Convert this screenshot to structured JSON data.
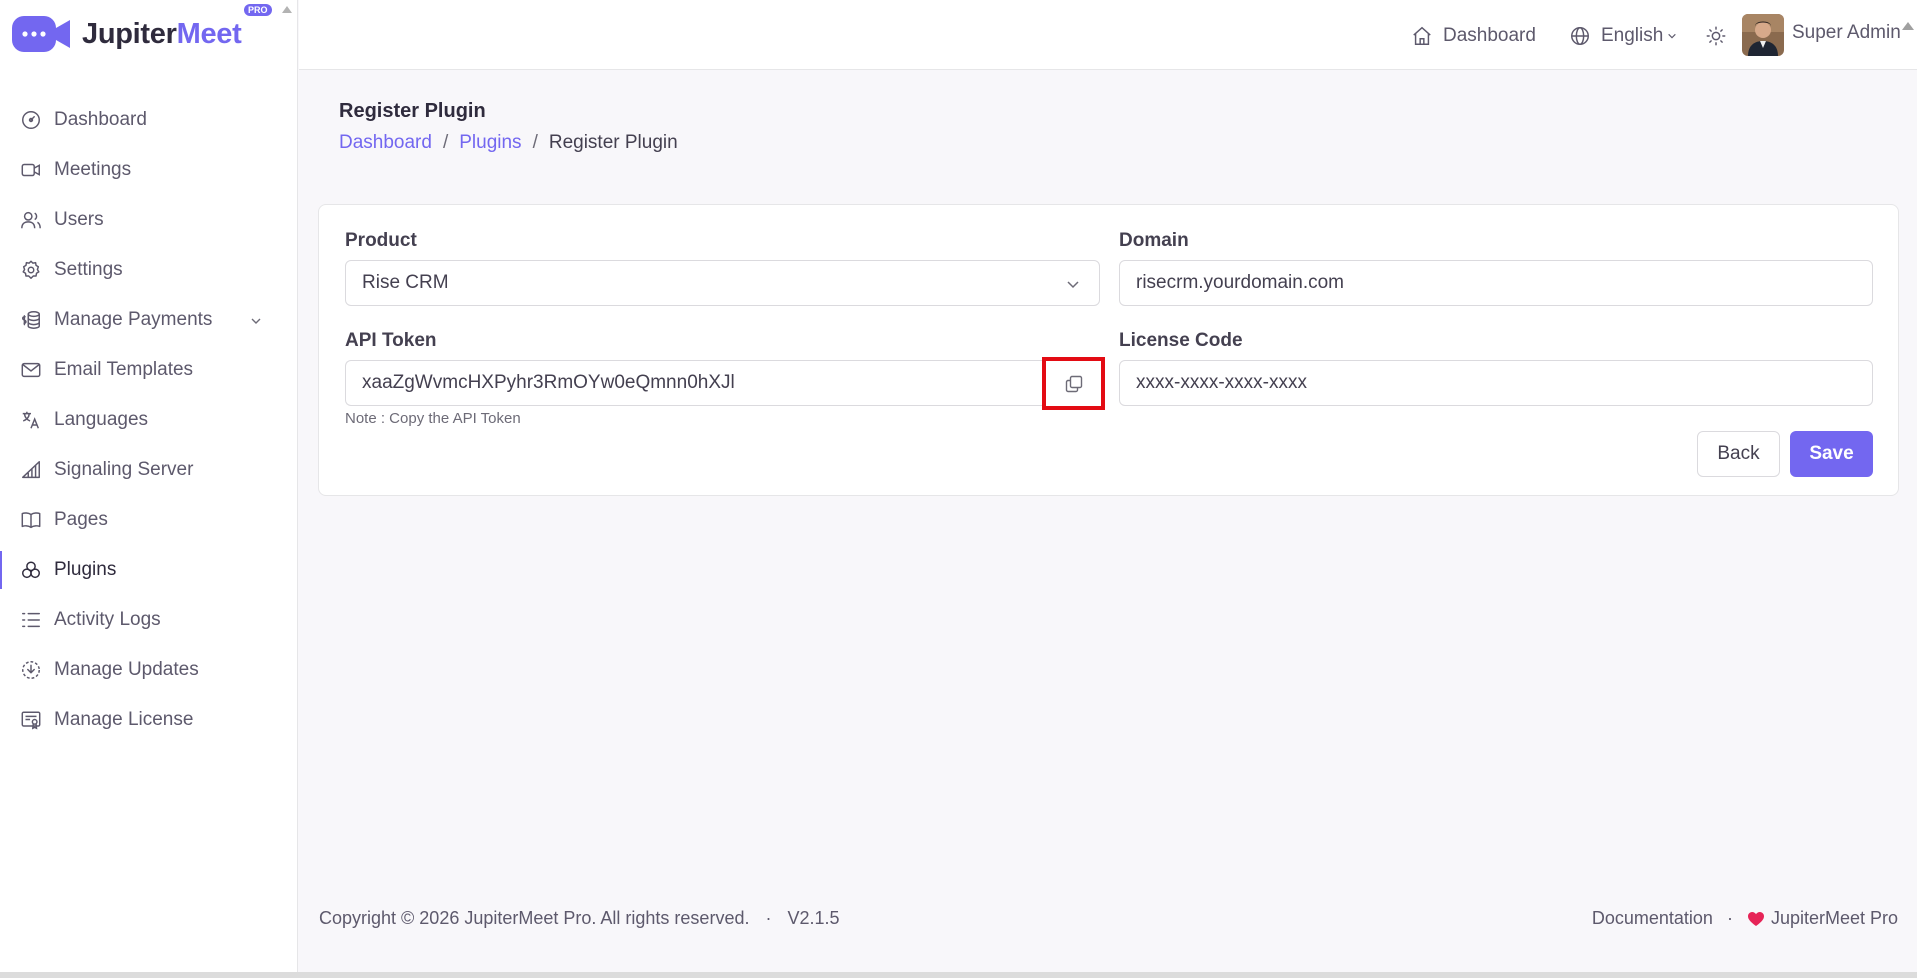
{
  "app": {
    "name_part1": "Jupiter",
    "name_part2": "Meet",
    "badge": "PRO"
  },
  "sidebar": {
    "items": [
      {
        "label": "Dashboard",
        "icon": "dashboard-icon"
      },
      {
        "label": "Meetings",
        "icon": "video-icon"
      },
      {
        "label": "Users",
        "icon": "users-icon"
      },
      {
        "label": "Settings",
        "icon": "gear-icon"
      },
      {
        "label": "Manage Payments",
        "icon": "payments-icon",
        "has_submenu": true
      },
      {
        "label": "Email Templates",
        "icon": "mail-icon"
      },
      {
        "label": "Languages",
        "icon": "language-icon"
      },
      {
        "label": "Signaling Server",
        "icon": "signal-icon"
      },
      {
        "label": "Pages",
        "icon": "book-icon"
      },
      {
        "label": "Plugins",
        "icon": "plugins-icon",
        "active": true
      },
      {
        "label": "Activity Logs",
        "icon": "list-icon"
      },
      {
        "label": "Manage Updates",
        "icon": "update-icon"
      },
      {
        "label": "Manage License",
        "icon": "license-icon"
      }
    ]
  },
  "topbar": {
    "dashboard": "Dashboard",
    "language": "English",
    "user_name": "Super Admin"
  },
  "page": {
    "title": "Register Plugin",
    "breadcrumb": [
      "Dashboard",
      "Plugins",
      "Register Plugin"
    ],
    "separator": "/"
  },
  "form": {
    "product_label": "Product",
    "product_value": "Rise CRM",
    "domain_label": "Domain",
    "domain_value": "risecrm.yourdomain.com",
    "api_token_label": "API Token",
    "api_token_value": "xaaZgWvmcHXPyhr3RmOYw0eQmnn0hXJl",
    "license_label": "License Code",
    "license_placeholder": "xxxx-xxxx-xxxx-xxxx",
    "note": "Note : Copy the API Token",
    "back_label": "Back",
    "save_label": "Save"
  },
  "footer": {
    "copyright": "Copyright © 2026 JupiterMeet Pro. All rights reserved.",
    "version": "V2.1.5",
    "dot": "·",
    "documentation": "Documentation",
    "brand": "JupiterMeet Pro"
  },
  "colors": {
    "accent": "#7367f0",
    "highlight_border": "#e30b13",
    "heart": "#e62457"
  }
}
